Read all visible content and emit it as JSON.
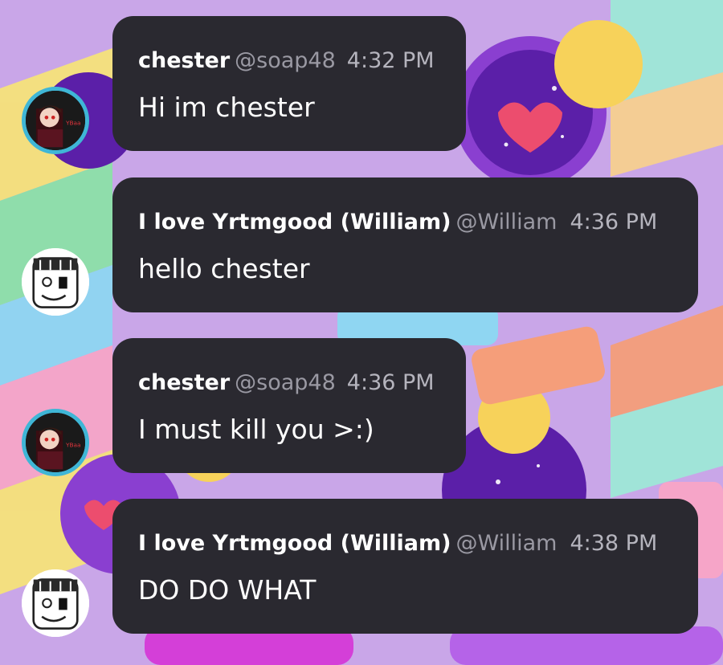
{
  "messages": [
    {
      "author": "chester",
      "handle": "@soap48",
      "time": "4:32 PM",
      "text": "Hi im chester",
      "avatar_icon": "chester-avatar-icon"
    },
    {
      "author": "I love Yrtmgood (William)",
      "handle": "@William",
      "time": "4:36 PM",
      "text": "hello chester",
      "avatar_icon": "william-avatar-icon"
    },
    {
      "author": "chester",
      "handle": "@soap48",
      "time": "4:36 PM",
      "text": "I must kill you >:)",
      "avatar_icon": "chester-avatar-icon"
    },
    {
      "author": "I love Yrtmgood (William)",
      "handle": "@William",
      "time": "4:38 PM",
      "text": "DO DO WHAT",
      "avatar_icon": "william-avatar-icon"
    }
  ],
  "colors": {
    "bubble": "#2a2930",
    "name": "#ffffff",
    "handle": "#9a99a3",
    "time": "#b5b4bd",
    "chester_avatar_ring": "#3fb6d6"
  }
}
